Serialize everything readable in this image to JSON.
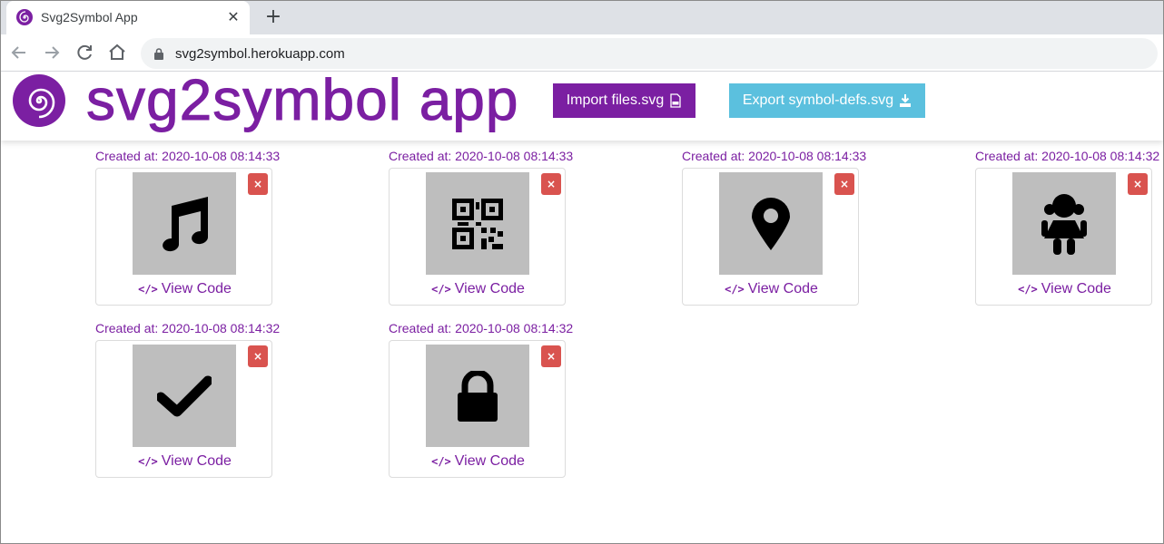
{
  "browser": {
    "tab_title": "Svg2Symbol App",
    "url": "svg2symbol.herokuapp.com"
  },
  "app": {
    "title": "svg2symbol app",
    "import_label": "Import files.svg",
    "export_label": "Export symbol-defs.svg",
    "accent_color": "#7b1fa2",
    "export_color": "#5bc0de",
    "delete_color": "#d9534f"
  },
  "icons": [
    {
      "icon": "music-note-icon",
      "created": "Created at: 2020-10-08 08:14:33",
      "view": "View Code",
      "delete": "×"
    },
    {
      "icon": "qr-code-icon",
      "created": "Created at: 2020-10-08 08:14:33",
      "view": "View Code",
      "delete": "×"
    },
    {
      "icon": "map-marker-icon",
      "created": "Created at: 2020-10-08 08:14:33",
      "view": "View Code",
      "delete": "×"
    },
    {
      "icon": "girl-icon",
      "created": "Created at: 2020-10-08 08:14:32",
      "view": "View Code",
      "delete": "×"
    },
    {
      "icon": "check-icon",
      "created": "Created at: 2020-10-08 08:14:32",
      "view": "View Code",
      "delete": "×"
    },
    {
      "icon": "lock-icon",
      "created": "Created at: 2020-10-08 08:14:32",
      "view": "View Code",
      "delete": "×"
    }
  ]
}
